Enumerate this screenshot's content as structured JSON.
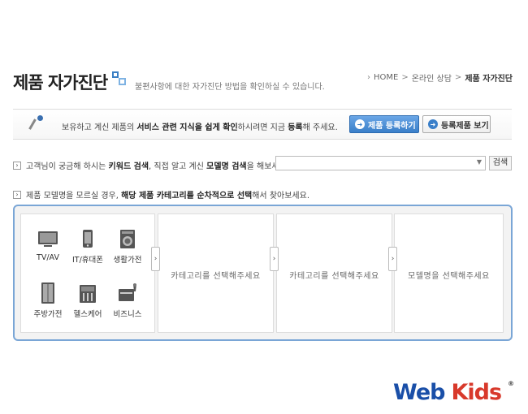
{
  "header": {
    "title": "제품 자가진단",
    "subtitle": "불편사항에 대한 자가진단 방법을 확인하실 수 있습니다.",
    "breadcrumb": [
      "HOME",
      "온라인 상담",
      "제품 자가진단"
    ]
  },
  "info_bar": {
    "text_prefix": "보유하고 계신 제품의 ",
    "text_bold1": "서비스 관련 지식을 쉽게 확인",
    "text_mid": "하시려면 지금 ",
    "text_bold2": "등록",
    "text_suffix": "해 주세요.",
    "register_button": "제품 등록하기",
    "view_button": "등록제품 보기"
  },
  "search": {
    "label_prefix": "고객님이 궁금해 하시는 ",
    "label_bold1": "키워드 검색",
    "label_mid": ", 직접 알고 계신 ",
    "label_bold2": "모델명 검색",
    "label_suffix": "을 해보세요.",
    "button": "검색"
  },
  "category_hint": {
    "prefix": "제품 모델명을 모르실 경우, ",
    "bold": "해당 제품 카테고리를 순차적으로 선택",
    "suffix": "해서 찾아보세요."
  },
  "categories": [
    {
      "label": "TV/AV",
      "icon": "tv-icon"
    },
    {
      "label": "IT/휴대폰",
      "icon": "phone-icon"
    },
    {
      "label": "생활가전",
      "icon": "washer-icon"
    },
    {
      "label": "주방가전",
      "icon": "fridge-icon"
    },
    {
      "label": "헬스케어",
      "icon": "healthcare-icon"
    },
    {
      "label": "비즈니스",
      "icon": "business-icon"
    }
  ],
  "columns": {
    "category1": "카테고리를 선택해주세요",
    "category2": "카테고리를 선택해주세요",
    "model": "모델명을 선택해주세요"
  },
  "logo": {
    "part1": "Web",
    "part2": "Kids",
    "mark": "®"
  },
  "colors": {
    "accent": "#3a7fc9",
    "panel_border": "#7aa6d6"
  }
}
